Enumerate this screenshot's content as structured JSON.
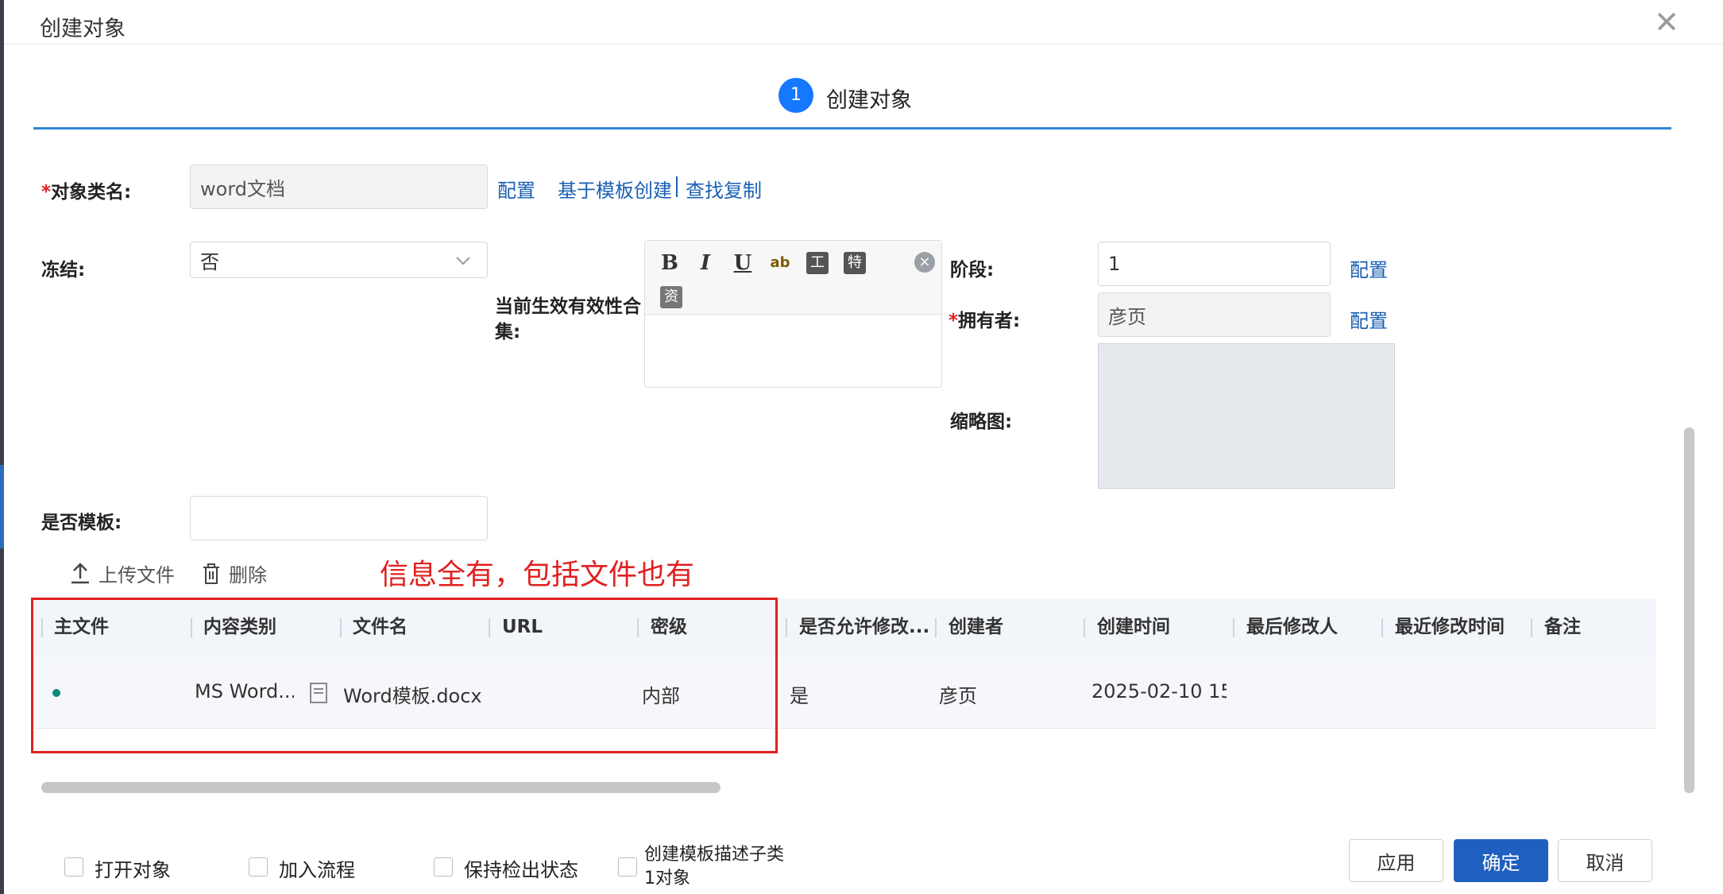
{
  "dialog": {
    "title": "创建对象",
    "close_symbol": "✕"
  },
  "steps": [
    {
      "number": "1",
      "label": "创建对象"
    }
  ],
  "form": {
    "object_class": {
      "label": "对象类名:",
      "required_mark": "*",
      "value": "word文档"
    },
    "object_class_links": {
      "config": "配置",
      "from_template": "基于模板创建",
      "find_copy": "查找复制"
    },
    "frozen": {
      "label": "冻结:",
      "value": "否"
    },
    "effective_set": {
      "label_line1": "当前生效有效性合",
      "label_line2": "集:"
    },
    "editor_toolbar": {
      "bold": "B",
      "italic": "I",
      "underline": "U",
      "spell": "ab",
      "format": "工",
      "special": "特",
      "resource": "资",
      "clear": "×"
    },
    "stage": {
      "label": "阶段:",
      "value": "1",
      "config": "配置"
    },
    "owner": {
      "label": "拥有者:",
      "required_mark": "*",
      "value": "彦页",
      "config": "配置"
    },
    "thumbnail": {
      "label": "缩略图:"
    },
    "is_template": {
      "label": "是否模板:",
      "value": ""
    }
  },
  "file_toolbar": {
    "upload": "上传文件",
    "delete": "删除"
  },
  "annotation": {
    "text": "信息全有，包括文件也有",
    "color": "#e02020"
  },
  "table": {
    "columns": [
      "主文件",
      "内容类别",
      "文件名",
      "URL",
      "密级",
      "是否允许修改...",
      "创建者",
      "创建时间",
      "最后修改人",
      "最近修改时间",
      "备注"
    ],
    "rows": [
      {
        "content_type": "MS Word...",
        "file_name": "Word模板.docx",
        "url": "",
        "security": "内部",
        "allow_modify": "是",
        "creator": "彦页",
        "created": "2025-02-10 15:(",
        "last_modifier": "",
        "modified": "",
        "remark": ""
      }
    ]
  },
  "footer": {
    "checkboxes": [
      "打开对象",
      "加入流程",
      "保持检出状态",
      "创建模板描述子类"
    ],
    "checkbox_4_line2": "1对象",
    "buttons": {
      "apply": "应用",
      "ok": "确定",
      "cancel": "取消"
    }
  },
  "colors": {
    "primary": "#1f5fbf",
    "step": "#1677ff",
    "link": "#1a5fb4",
    "required": "#e02020",
    "main_file_dot": "#0d8a7d"
  },
  "icons": [
    "close-icon",
    "chevron-down-icon",
    "upload-icon",
    "trash-icon",
    "file-type-icon"
  ]
}
